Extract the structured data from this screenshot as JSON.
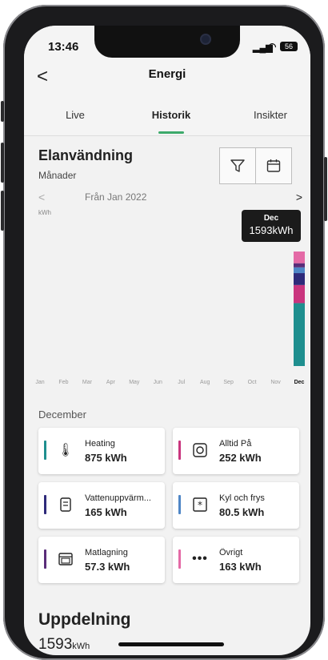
{
  "status": {
    "time": "13:46",
    "battery": "56"
  },
  "header": {
    "title": "Energi",
    "back_label": "<"
  },
  "tabs": [
    {
      "label": "Live",
      "active": false
    },
    {
      "label": "Historik",
      "active": true
    },
    {
      "label": "Insikter",
      "active": false
    }
  ],
  "card": {
    "title": "Elanvändning",
    "subtitle": "Månader",
    "nav_label": "Från Jan 2022",
    "prev_label": "<",
    "next_label": ">",
    "unit_label": "kWh"
  },
  "tooltip": {
    "month": "Dec",
    "value": "1593kWh"
  },
  "chart_data": {
    "type": "bar",
    "stacked": true,
    "ylabel": "kWh",
    "categories": [
      "Jan",
      "Feb",
      "Mar",
      "Apr",
      "May",
      "Jun",
      "Jul",
      "Aug",
      "Sep",
      "Oct",
      "Nov",
      "Dec"
    ],
    "highlighted_category": "Dec",
    "series": [
      {
        "name": "Heating",
        "color": "#1f8f8f",
        "values": [
          0,
          0,
          0,
          0,
          0,
          0,
          0,
          0,
          0,
          0,
          0,
          875
        ]
      },
      {
        "name": "Alltid På",
        "color": "#c9357e",
        "values": [
          0,
          0,
          0,
          0,
          0,
          0,
          0,
          0,
          0,
          0,
          0,
          252
        ]
      },
      {
        "name": "Vattenuppvärmning",
        "color": "#2e2a7a",
        "values": [
          0,
          0,
          0,
          0,
          0,
          0,
          0,
          0,
          0,
          0,
          0,
          165
        ]
      },
      {
        "name": "Kyl och frys",
        "color": "#4f86c6",
        "values": [
          0,
          0,
          0,
          0,
          0,
          0,
          0,
          0,
          0,
          0,
          0,
          80.5
        ]
      },
      {
        "name": "Matlagning",
        "color": "#5a2d79",
        "values": [
          0,
          0,
          0,
          0,
          0,
          0,
          0,
          0,
          0,
          0,
          0,
          57.3
        ]
      },
      {
        "name": "Övrigt",
        "color": "#e46aa6",
        "values": [
          0,
          0,
          0,
          0,
          0,
          0,
          0,
          0,
          0,
          0,
          0,
          163
        ]
      }
    ],
    "total": 1593
  },
  "breakdown": {
    "section_label": "December",
    "items": [
      {
        "label": "Heating",
        "value": "875 kWh",
        "color": "#1f8f8f",
        "icon": "thermometer-icon"
      },
      {
        "label": "Alltid På",
        "value": "252 kWh",
        "color": "#c9357e",
        "icon": "power-socket-icon"
      },
      {
        "label": "Vattenuppvärm...",
        "value": "165 kWh",
        "color": "#2e2a7a",
        "icon": "water-heater-icon"
      },
      {
        "label": "Kyl och frys",
        "value": "80.5 kWh",
        "color": "#4f86c6",
        "icon": "snowflake-icon"
      },
      {
        "label": "Matlagning",
        "value": "57.3 kWh",
        "color": "#5a2d79",
        "icon": "oven-icon"
      },
      {
        "label": "Övrigt",
        "value": "163 kWh",
        "color": "#e46aa6",
        "icon": "more-dots-icon"
      }
    ]
  },
  "uppdelning": {
    "title": "Uppdelning",
    "value": "1593",
    "unit": "kWh"
  }
}
